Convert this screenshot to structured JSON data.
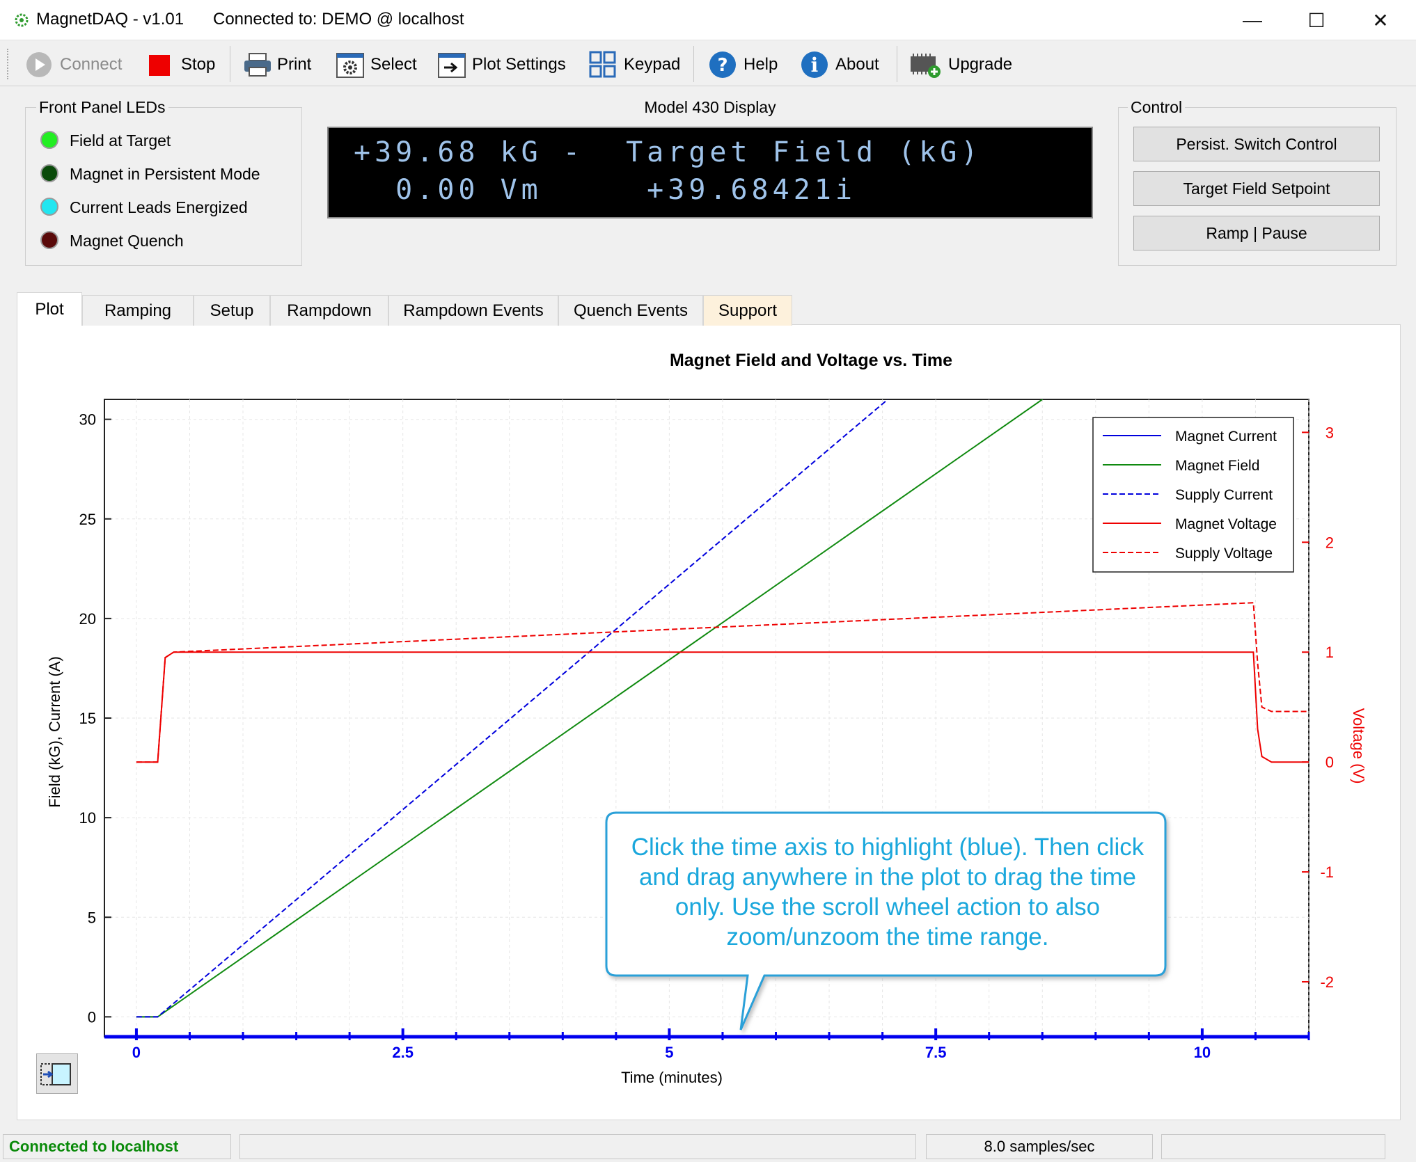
{
  "window": {
    "app_title": "MagnetDAQ - v1.01",
    "connection_title": "Connected to: DEMO @ localhost",
    "minimize_glyph": "—",
    "maximize_glyph": "☐",
    "close_glyph": "✕"
  },
  "toolbar": {
    "connect": "Connect",
    "stop": "Stop",
    "print": "Print",
    "select": "Select",
    "plot_settings": "Plot Settings",
    "keypad": "Keypad",
    "help": "Help",
    "about": "About",
    "upgrade": "Upgrade"
  },
  "leds": {
    "title": "Front Panel LEDs",
    "items": [
      {
        "label": "Field at Target",
        "color": "#22ee22"
      },
      {
        "label": "Magnet in Persistent Mode",
        "color": "#0a4a0a"
      },
      {
        "label": "Current Leads Energized",
        "color": "#22e6f0"
      },
      {
        "label": "Magnet Quench",
        "color": "#5a0a0a"
      }
    ]
  },
  "display": {
    "title": "Model 430 Display",
    "line1": "+39.68 kG -  Target Field (kG)",
    "line2": "  0.00 Vm     +39.68421i"
  },
  "control": {
    "title": "Control",
    "persist_switch": "Persist. Switch Control",
    "target_setpoint": "Target Field Setpoint",
    "ramp_pause": "Ramp | Pause"
  },
  "tabs": [
    "Plot",
    "Ramping",
    "Setup",
    "Rampdown",
    "Rampdown Events",
    "Quench Events",
    "Support"
  ],
  "callout": "Click the time axis to highlight (blue). Then click and drag anywhere in the plot to drag the time only. Use the scroll wheel action to also zoom/unzoom the time range.",
  "status": {
    "connection": "Connected to localhost",
    "rate": "8.0 samples/sec"
  },
  "colors": {
    "magnet_current": "#0000dd",
    "magnet_field": "#108a10",
    "supply_current": "#0000dd",
    "magnet_voltage": "#ee0000",
    "supply_voltage": "#ee0000",
    "highlight_axis": "#0000ee",
    "callout_text": "#1aa7dc",
    "status_green": "#0a8a0a"
  },
  "chart_data": {
    "type": "line",
    "title": "Magnet Field and Voltage vs. Time",
    "xlabel": "Time (minutes)",
    "ylabel": "Field (kG), Current (A)",
    "y2label": "Voltage (V)",
    "xlim": [
      -0.3,
      11.0
    ],
    "ylim": [
      -1.0,
      31.0
    ],
    "y2lim": [
      -2.5,
      3.3
    ],
    "xticks": [
      "0",
      "2.5",
      "5",
      "7.5",
      "10"
    ],
    "xtick_values": [
      0,
      2.5,
      5,
      7.5,
      10
    ],
    "yticks": [
      "0",
      "5",
      "10",
      "15",
      "20",
      "25",
      "30"
    ],
    "ytick_values": [
      0,
      5,
      10,
      15,
      20,
      25,
      30
    ],
    "y2ticks": [
      "-2",
      "-1",
      "0",
      "1",
      "2",
      "3"
    ],
    "y2tick_values": [
      -2,
      -1,
      0,
      1,
      2,
      3
    ],
    "legend_position": "top-right",
    "grid": true,
    "series": [
      {
        "name": "Magnet Current",
        "axis": "left",
        "style": "solid",
        "x": [
          0,
          0.2
        ],
        "y": [
          0,
          0
        ]
      },
      {
        "name": "Magnet Field",
        "axis": "left",
        "style": "solid",
        "x": [
          0,
          0.2,
          8.5
        ],
        "y": [
          0,
          0,
          31.0
        ]
      },
      {
        "name": "Supply Current",
        "axis": "left",
        "style": "dashed",
        "x": [
          0,
          0.2,
          7.05
        ],
        "y": [
          0,
          0,
          31.0
        ]
      },
      {
        "name": "Magnet Voltage",
        "axis": "right",
        "style": "solid",
        "x": [
          0,
          0.2,
          0.27,
          0.35,
          10.48,
          10.52,
          10.56,
          10.65,
          11.0
        ],
        "y": [
          0,
          0,
          0.95,
          1.0,
          1.0,
          0.3,
          0.05,
          0,
          0
        ]
      },
      {
        "name": "Supply Voltage",
        "axis": "right",
        "style": "dashed",
        "x": [
          0,
          0.2,
          0.27,
          0.35,
          10.48,
          10.52,
          10.56,
          10.65,
          11.0
        ],
        "y": [
          0,
          0,
          0.95,
          1.0,
          1.45,
          0.9,
          0.5,
          0.46,
          0.46
        ]
      }
    ]
  }
}
